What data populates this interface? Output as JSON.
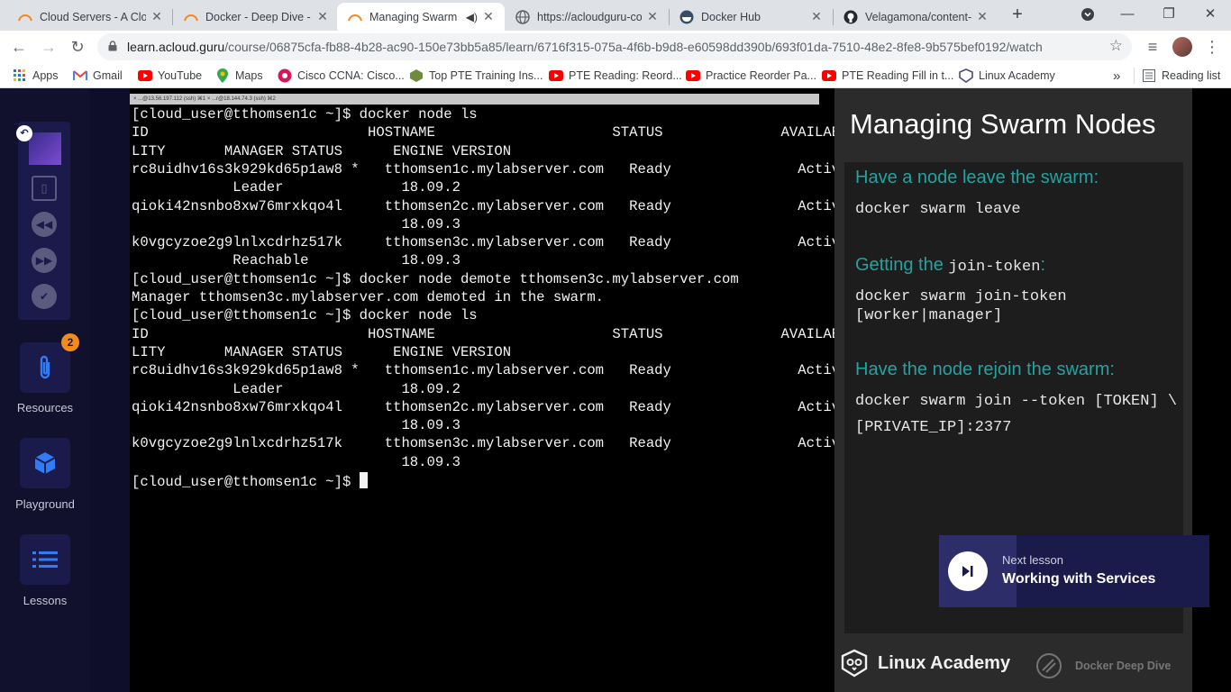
{
  "browser": {
    "tabs": [
      {
        "title": "Cloud Servers - A Clou",
        "icon": "acloudguru-icon"
      },
      {
        "title": "Docker - Deep Dive - A",
        "icon": "acloudguru-icon"
      },
      {
        "title": "Managing Swarm",
        "icon": "acloudguru-icon",
        "active": true
      },
      {
        "title": "https://acloudguru-co",
        "icon": "globe-icon"
      },
      {
        "title": "Docker Hub",
        "icon": "docker-icon"
      },
      {
        "title": "Velagamona/content-",
        "icon": "github-icon"
      }
    ],
    "url_host": "learn.acloud.guru",
    "url_path": "/course/06875cfa-fb88-4b28-ac90-150e73bb5a85/learn/6716f315-075a-4f6b-b9d8-e60598dd390b/693f01da-7510-48e2-8fe8-9b575bef0192/watch",
    "bookmarks": [
      {
        "label": "Apps",
        "icon": "apps-grid-icon"
      },
      {
        "label": "Gmail",
        "icon": "gmail-icon"
      },
      {
        "label": "YouTube",
        "icon": "youtube-icon"
      },
      {
        "label": "Maps",
        "icon": "maps-icon"
      },
      {
        "label": "Cisco CCNA: Cisco...",
        "icon": "cisco-icon"
      },
      {
        "label": "Top PTE Training Ins...",
        "icon": "pte-icon"
      },
      {
        "label": "PTE Reading: Reord...",
        "icon": "youtube-icon"
      },
      {
        "label": "Practice Reorder Pa...",
        "icon": "youtube-icon"
      },
      {
        "label": "PTE Reading Fill in t...",
        "icon": "youtube-icon"
      },
      {
        "label": "Linux Academy",
        "icon": "linux-academy-icon"
      }
    ],
    "reading_list": "Reading list",
    "more": "»"
  },
  "sidebar": {
    "resources": {
      "label": "Resources",
      "badge": "2"
    },
    "playground": {
      "label": "Playground"
    },
    "lessons": {
      "label": "Lessons"
    }
  },
  "terminal": {
    "tab_labels": "×  ...@13.56.197.112 (ssh)  ⌘1   ×  ...r@18.144.74.3 (ssh)  ⌘2",
    "lines": [
      "[cloud_user@tthomsen1c ~]$ docker node ls",
      "ID                          HOSTNAME                     STATUS              AVAILABI",
      "LITY       MANAGER STATUS      ENGINE VERSION",
      "rc8uidhv16s3k929kd65p1aw8 *   tthomsen1c.mylabserver.com   Ready               Active",
      "            Leader              18.09.2",
      "qioki42nsnbo8xw76mrxkqo4l     tthomsen2c.mylabserver.com   Ready               Active",
      "                                18.09.3",
      "k0vgcyzoe2g9lnlxcdrhz517k     tthomsen3c.mylabserver.com   Ready               Active",
      "            Reachable           18.09.3",
      "[cloud_user@tthomsen1c ~]$ docker node demote tthomsen3c.mylabserver.com",
      "Manager tthomsen3c.mylabserver.com demoted in the swarm.",
      "[cloud_user@tthomsen1c ~]$ docker node ls",
      "ID                          HOSTNAME                     STATUS              AVAILABI",
      "LITY       MANAGER STATUS      ENGINE VERSION",
      "rc8uidhv16s3k929kd65p1aw8 *   tthomsen1c.mylabserver.com   Ready               Active",
      "            Leader              18.09.2",
      "qioki42nsnbo8xw76mrxkqo4l     tthomsen2c.mylabserver.com   Ready               Active",
      "                                18.09.3",
      "k0vgcyzoe2g9lnlxcdrhz517k     tthomsen3c.mylabserver.com   Ready               Active",
      "                                18.09.3"
    ],
    "prompt": "[cloud_user@tthomsen1c ~]$ "
  },
  "slide": {
    "title": "Managing Swarm Nodes",
    "section1_heading": "Have a node leave the swarm:",
    "section1_code": "docker swarm leave",
    "section2_heading_prefix": "Getting the ",
    "section2_heading_code": "join-token",
    "section2_heading_suffix": ":",
    "section2_code": "docker swarm join-token\n[worker|manager]",
    "section3_heading": "Have the node rejoin the swarm:",
    "section3_code_line1": "docker swarm join --token [TOKEN] \\",
    "section3_code_line2": "[PRIVATE_IP]:2377"
  },
  "next_lesson": {
    "label": "Next lesson",
    "title": "Working with Services"
  },
  "branding": {
    "logo": "Linux Academy",
    "course": "Docker Deep Dive"
  },
  "colors": {
    "accent_teal": "#23a3a0",
    "nav_dark": "#1b1b4b",
    "badge": "#f28b1b"
  }
}
